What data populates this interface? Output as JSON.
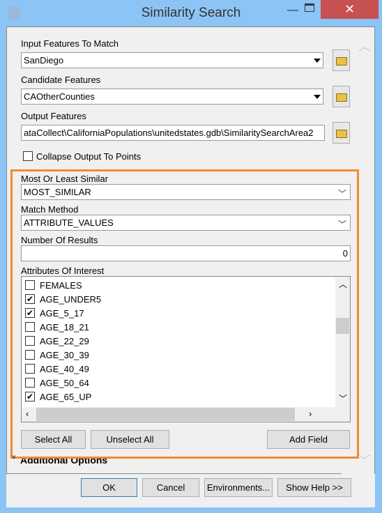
{
  "window": {
    "title": "Similarity Search",
    "close_glyph": "✕",
    "min_glyph": "—"
  },
  "input_features": {
    "label": "Input Features To Match",
    "value": "SanDiego"
  },
  "candidate_features": {
    "label": "Candidate Features",
    "value": "CAOtherCounties"
  },
  "output_features": {
    "label": "Output Features",
    "value": "ataCollect\\CaliforniaPopulations\\unitedstates.gdb\\SimilaritySearchArea2"
  },
  "collapse": {
    "label": "Collapse Output To Points",
    "checked": false
  },
  "most_least": {
    "label": "Most Or Least Similar",
    "value": "MOST_SIMILAR"
  },
  "match_method": {
    "label": "Match Method",
    "value": "ATTRIBUTE_VALUES"
  },
  "num_results": {
    "label": "Number Of Results",
    "value": "0"
  },
  "attributes": {
    "label": "Attributes Of Interest",
    "items": [
      {
        "name": "FEMALES",
        "checked": false
      },
      {
        "name": "AGE_UNDER5",
        "checked": true
      },
      {
        "name": "AGE_5_17",
        "checked": true
      },
      {
        "name": "AGE_18_21",
        "checked": false
      },
      {
        "name": "AGE_22_29",
        "checked": false
      },
      {
        "name": "AGE_30_39",
        "checked": false
      },
      {
        "name": "AGE_40_49",
        "checked": false
      },
      {
        "name": "AGE_50_64",
        "checked": false
      },
      {
        "name": "AGE_65_UP",
        "checked": true
      }
    ]
  },
  "list_buttons": {
    "select_all": "Select All",
    "unselect_all": "Unselect All",
    "add_field": "Add Field"
  },
  "additional_options": "Additional Options",
  "footer": {
    "ok": "OK",
    "cancel": "Cancel",
    "environments": "Environments...",
    "show_help": "Show Help >>"
  },
  "colors": {
    "highlight": "#f28a30",
    "window_frame": "#8cc4f5",
    "close": "#c75050"
  }
}
